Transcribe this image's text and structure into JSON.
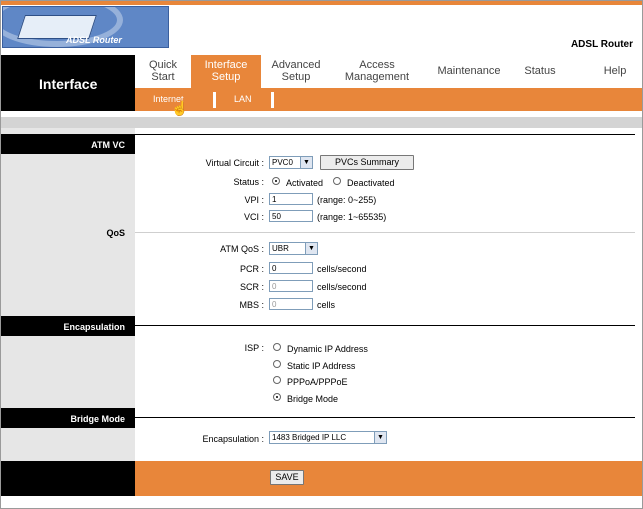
{
  "brand": {
    "logo_text": "ADSL Router",
    "product": "ADSL Router"
  },
  "nav": {
    "section_title": "Interface",
    "menu": [
      {
        "label": "Quick\nStart"
      },
      {
        "label": "Interface\nSetup"
      },
      {
        "label": "Advanced\nSetup"
      },
      {
        "label": "Access\nManagement"
      },
      {
        "label": "Maintenance"
      },
      {
        "label": "Status"
      },
      {
        "label": "Help"
      }
    ],
    "sub": [
      "Internet",
      "LAN"
    ]
  },
  "sections": {
    "atm_vc": "ATM VC",
    "qos": "QoS",
    "encapsulation": "Encapsulation",
    "bridge": "Bridge Mode"
  },
  "atm": {
    "vc_label": "Virtual Circuit :",
    "vc_value": "PVC0",
    "pvc_summary": "PVCs Summary",
    "status_label": "Status :",
    "activated": "Activated",
    "deactivated": "Deactivated",
    "vpi_label": "VPI :",
    "vpi_value": "1",
    "vpi_range": "(range: 0~255)",
    "vci_label": "VCI :",
    "vci_value": "50",
    "vci_range": "(range: 1~65535)"
  },
  "qos": {
    "atmqos_label": "ATM QoS :",
    "atmqos_value": "UBR",
    "pcr_label": "PCR :",
    "pcr_value": "0",
    "pcr_unit": "cells/second",
    "scr_label": "SCR :",
    "scr_value": "0",
    "scr_unit": "cells/second",
    "mbs_label": "MBS :",
    "mbs_value": "0",
    "mbs_unit": "cells"
  },
  "isp": {
    "label": "ISP :",
    "options": [
      "Dynamic IP Address",
      "Static IP Address",
      "PPPoA/PPPoE",
      "Bridge Mode"
    ]
  },
  "bridge": {
    "encap_label": "Encapsulation :",
    "encap_value": "1483 Bridged IP LLC"
  },
  "footer": {
    "save": "SAVE"
  },
  "colors": {
    "accent": "#e8863a",
    "dark": "#000000",
    "sidebar": "#e6e6e6"
  }
}
